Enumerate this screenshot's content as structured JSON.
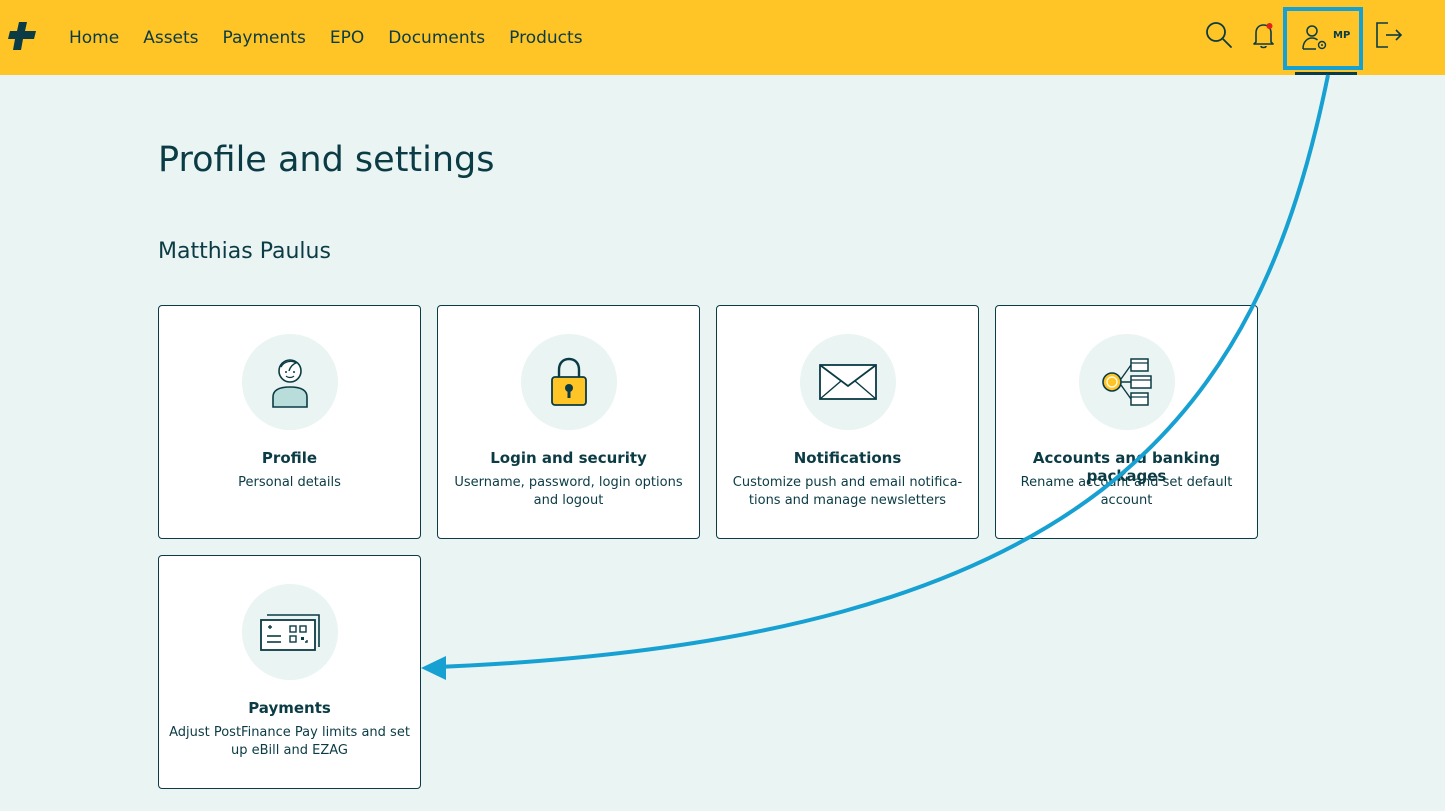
{
  "nav": {
    "items": [
      {
        "label": "Home"
      },
      {
        "label": "Assets"
      },
      {
        "label": "Payments"
      },
      {
        "label": "EPO"
      },
      {
        "label": "Documents"
      },
      {
        "label": "Products"
      }
    ]
  },
  "header": {
    "user_initials": "MP",
    "icons": [
      "search-icon",
      "bell-icon",
      "user-settings-icon",
      "logout-icon"
    ],
    "notification_dot_color": "#e2231a"
  },
  "page": {
    "title": "Profile and settings",
    "user_name": "Matthias Paulus"
  },
  "cards": [
    {
      "title": "Profile",
      "description": "Personal details",
      "icon": "person-icon"
    },
    {
      "title": "Login and security",
      "description": "Username, password, login options and logout",
      "icon": "padlock-icon"
    },
    {
      "title": "Notifications",
      "description": "Customize push and email notifica-tions and manage newsletters",
      "icon": "envelope-icon"
    },
    {
      "title": "Accounts and banking packages",
      "description": "Rename account and set default account",
      "icon": "accounts-icon"
    },
    {
      "title": "Payments",
      "description": "Adjust PostFinance Pay limits and set up eBill and EZAG",
      "icon": "payment-slip-icon"
    }
  ],
  "colors": {
    "header_bg": "#ffc426",
    "page_bg": "#e9f4f3",
    "text": "#0b3b44",
    "highlight": "#17a0d2"
  }
}
